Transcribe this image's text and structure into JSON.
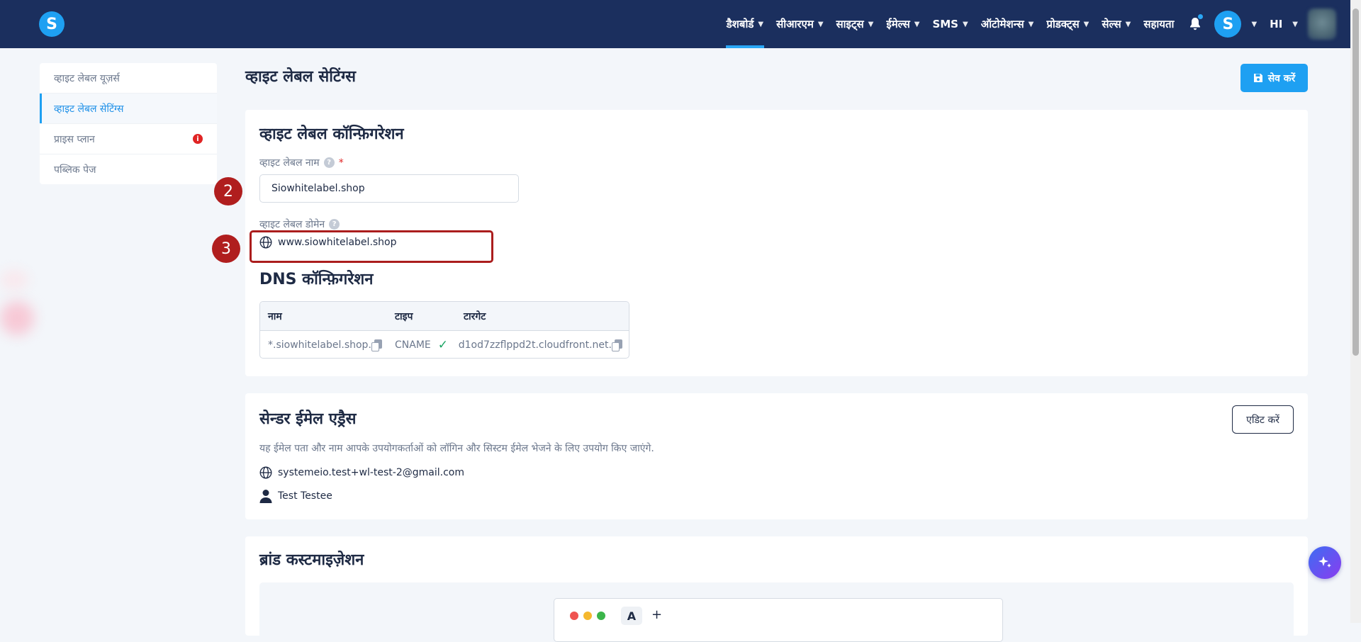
{
  "app": {
    "logo_letter": "S"
  },
  "nav": {
    "items": [
      {
        "label": "डैशबोर्ड",
        "active": true
      },
      {
        "label": "सीआरएम"
      },
      {
        "label": "साइट्स"
      },
      {
        "label": "ईमेल्स"
      },
      {
        "label": "SMS"
      },
      {
        "label": "ऑटोमेशन्स"
      },
      {
        "label": "प्रोडक्ट्स"
      },
      {
        "label": "सेल्स"
      },
      {
        "label": "सहायता"
      }
    ],
    "avatar_letter": "S",
    "language": "HI"
  },
  "sidebar": {
    "items": [
      {
        "label": "व्हाइट लेबल यूज़र्स"
      },
      {
        "label": "व्हाइट लेबल सेटिंग्स",
        "active": true
      },
      {
        "label": "प्राइस प्लान",
        "badge": "i"
      },
      {
        "label": "पब्लिक पेज"
      }
    ]
  },
  "page": {
    "title": "व्हाइट लेबल सेटिंग्स",
    "save_label": "सेव करें"
  },
  "config": {
    "title": "व्हाइट लेबल कॉन्फ़िगरेशन",
    "name_label": "व्हाइट लेबल नाम",
    "required_mark": "*",
    "name_value": "Siowhitelabel.shop",
    "domain_label": "व्हाइट लेबल डोमेन",
    "domain_value": "www.siowhitelabel.shop",
    "help_glyph": "?",
    "step2": "2",
    "step3": "3",
    "highlight_color": "#ab1d1d"
  },
  "dns": {
    "title": "DNS कॉन्फ़िगरेशन",
    "headers": [
      "नाम",
      "टाइप",
      "टारगेट"
    ],
    "row": {
      "name": "*.siowhitelabel.shop.",
      "type": "CNAME",
      "target": "d1od7zzflppd2t.cloudfront.net."
    }
  },
  "sender": {
    "title": "सेन्डर ईमेल एड्रैस",
    "edit_label": "एडिट करें",
    "description": "यह ईमेल पता और नाम आपके उपयोगकर्ताओं को लॉगिन और सिस्टम ईमेल भेजने के लिए उपयोग किए जाएंगे.",
    "email": "systemeio.test+wl-test-2@gmail.com",
    "name": "Test Testee"
  },
  "brand": {
    "title": "ब्रांड कस्टमाइज़ेशन",
    "tab_letter": "A",
    "plus": "+"
  },
  "colors": {
    "accent": "#1ea0f2",
    "navbar": "#1b2f5e",
    "step_badge": "#b01e1e",
    "success": "#19a463"
  }
}
